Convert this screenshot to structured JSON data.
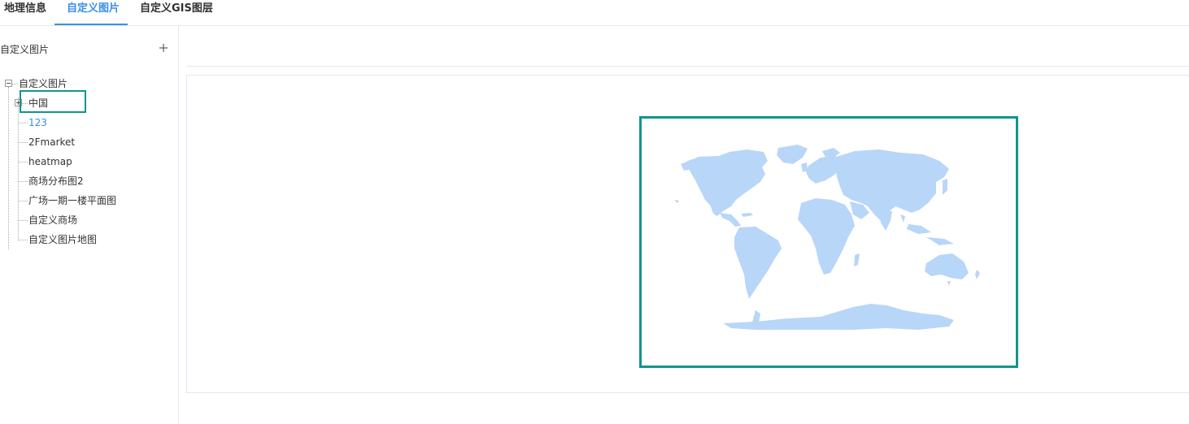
{
  "tabs": [
    {
      "label": "地理信息",
      "active": false
    },
    {
      "label": "自定义图片",
      "active": true
    },
    {
      "label": "自定义GIS图层",
      "active": false
    }
  ],
  "left_panel": {
    "title": "自定义图片",
    "add_icon": "plus-icon"
  },
  "tree": {
    "root": {
      "label": "自定义图片",
      "expanded": true
    },
    "children": [
      {
        "label": "中国",
        "expandable": true,
        "expanded": false
      },
      {
        "label": "123",
        "selected": true
      },
      {
        "label": "2Fmarket"
      },
      {
        "label": "heatmap"
      },
      {
        "label": "商场分布图2"
      },
      {
        "label": "广场一期一楼平面图"
      },
      {
        "label": "自定义商场"
      },
      {
        "label": "自定义图片地图"
      }
    ]
  },
  "preview": {
    "image_icon": "world-map-image",
    "land_color": "#b8d6f8",
    "highlight_color": "#0f958f"
  },
  "colors": {
    "accent": "#3a8ee6",
    "highlight": "#0f958f",
    "border": "#e4e7ed"
  }
}
